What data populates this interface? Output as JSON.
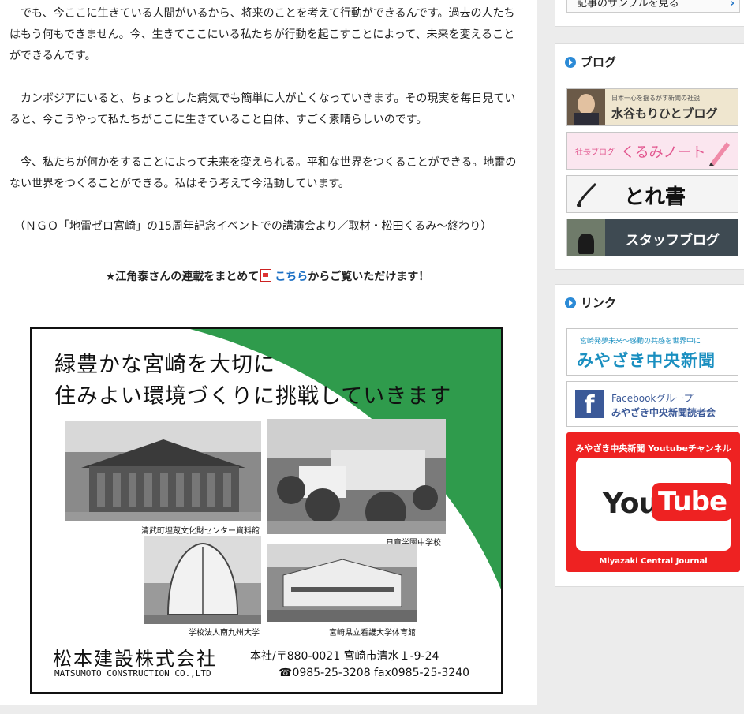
{
  "article": {
    "paragraphs": [
      "でも、今ここに生きている人間がいるから、将来のことを考えて行動ができるんです。過去の人たちはもう何もできません。今、生きてここにいる私たちが行動を起こすことによって、未来を変えることができるんです。",
      "カンボジアにいると、ちょっとした病気でも簡単に人が亡くなっていきます。その現実を毎日見ていると、今こうやって私たちがここに生きていること自体、すごく素晴らしいのです。",
      "今、私たちが何かをすることによって未来を変えられる。平和な世界をつくることができる。地雷のない世界をつくることができる。私はそう考えて今活動しています。"
    ],
    "credit": "（ＮＧＯ「地雷ゼロ宮崎」の15周年記念イベントでの講演会より／取材・松田くるみ～終わり）"
  },
  "promo": {
    "prefix": "★江角泰さんの連載をまとめて",
    "link": "こちら",
    "suffix": "からご覧いただけます！"
  },
  "ad": {
    "headline1": "緑豊かな宮崎を大切に",
    "headline2": "住みよい環境づくりに挑戦していきます",
    "captions": [
      "清武町埋蔵文化財センター資料館",
      "日章学園中学校",
      "学校法人南九州大学",
      "宮崎県立看護大学体育館"
    ],
    "company": "松本建設株式会社",
    "company_en": "MATSUMOTO CONSTRUCTION CO.,LTD",
    "address": "本社/〒880-0021 宮崎市清水１-9-24",
    "tel": "☎0985-25-3208 fax0985-25-3240",
    "accent": "#2f9b4c"
  },
  "sidebar": {
    "sample_button": "記事のサンプルを見る",
    "blog": {
      "title": "ブログ",
      "banners": [
        {
          "small": "日本一心を揺るがす新聞の社説",
          "label": "水谷もりひとブログ"
        },
        {
          "small": "社長ブログ",
          "label": "くるみノート"
        },
        {
          "label": "とれ書"
        },
        {
          "label": "スタッフブログ"
        }
      ]
    },
    "links": {
      "title": "リンク",
      "shinbun_small": "宮崎発夢未来～感動の共感を世界中に",
      "shinbun_label": "みやざき中央新聞",
      "fb_line1": "Facebookグループ",
      "fb_line2": "みやざき中央新聞読者会",
      "yt_top": "みやざき中央新聞 Youtubeチャンネル",
      "yt_you": "You",
      "yt_tube": "Tube",
      "yt_bottom": "Miyazaki Central Journal"
    }
  }
}
